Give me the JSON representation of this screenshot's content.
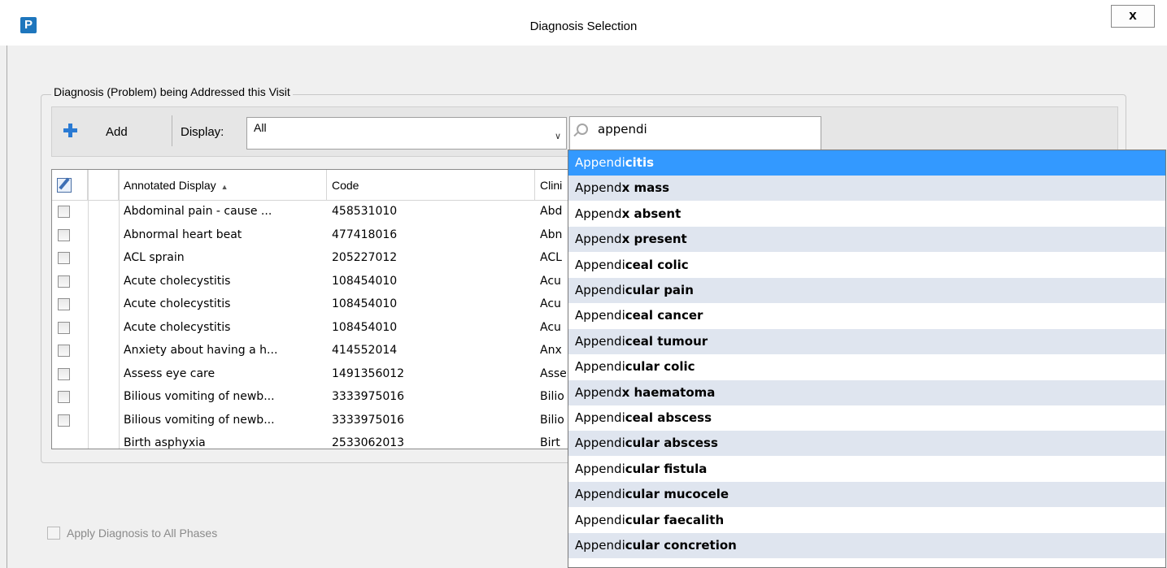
{
  "window": {
    "title": "Diagnosis Selection",
    "close": "x",
    "app_icon": "P"
  },
  "group": {
    "label": "Diagnosis (Problem) being Addressed this Visit"
  },
  "toolbar": {
    "add_label": "Add",
    "display_label": "Display:",
    "display_value": "All",
    "search_value": "appendi"
  },
  "grid": {
    "columns": [
      "",
      "",
      "Annotated Display",
      "Code",
      "Clini"
    ],
    "rows": [
      {
        "display": "Abdominal pain - cause ...",
        "code": "458531010",
        "clin": "Abd"
      },
      {
        "display": "Abnormal heart beat",
        "code": "477418016",
        "clin": "Abn"
      },
      {
        "display": "ACL sprain",
        "code": "205227012",
        "clin": "ACL"
      },
      {
        "display": "Acute cholecystitis",
        "code": "108454010",
        "clin": "Acu"
      },
      {
        "display": "Acute cholecystitis",
        "code": "108454010",
        "clin": "Acu"
      },
      {
        "display": "Acute cholecystitis",
        "code": "108454010",
        "clin": "Acu"
      },
      {
        "display": "Anxiety about having a h...",
        "code": "414552014",
        "clin": "Anx"
      },
      {
        "display": "Assess eye care",
        "code": "1491356012",
        "clin": "Asse"
      },
      {
        "display": "Bilious vomiting of newb...",
        "code": "3333975016",
        "clin": "Bilio"
      },
      {
        "display": "Bilious vomiting of newb...",
        "code": "3333975016",
        "clin": "Bilio"
      },
      {
        "display": "Birth asphyxia",
        "code": "2533062013",
        "clin": "Birt"
      }
    ]
  },
  "phases": {
    "label": "Apply Diagnosis to All Phases"
  },
  "suggestions": {
    "prefix": "Append",
    "items": [
      {
        "mid": "i",
        "rest": "citis"
      },
      {
        "mid": "",
        "rest": "x mass"
      },
      {
        "mid": "",
        "rest": "x absent"
      },
      {
        "mid": "",
        "rest": "x present"
      },
      {
        "mid": "i",
        "rest": "ceal colic"
      },
      {
        "mid": "i",
        "rest": "cular pain"
      },
      {
        "mid": "i",
        "rest": "ceal cancer"
      },
      {
        "mid": "i",
        "rest": "ceal tumour"
      },
      {
        "mid": "i",
        "rest": "cular colic"
      },
      {
        "mid": "",
        "rest": "x haematoma"
      },
      {
        "mid": "i",
        "rest": "ceal abscess"
      },
      {
        "mid": "i",
        "rest": "cular abscess"
      },
      {
        "mid": "i",
        "rest": "cular fistula"
      },
      {
        "mid": "i",
        "rest": "cular mucocele"
      },
      {
        "mid": "i",
        "rest": "cular faecalith"
      },
      {
        "mid": "i",
        "rest": "cular concretion"
      }
    ]
  }
}
